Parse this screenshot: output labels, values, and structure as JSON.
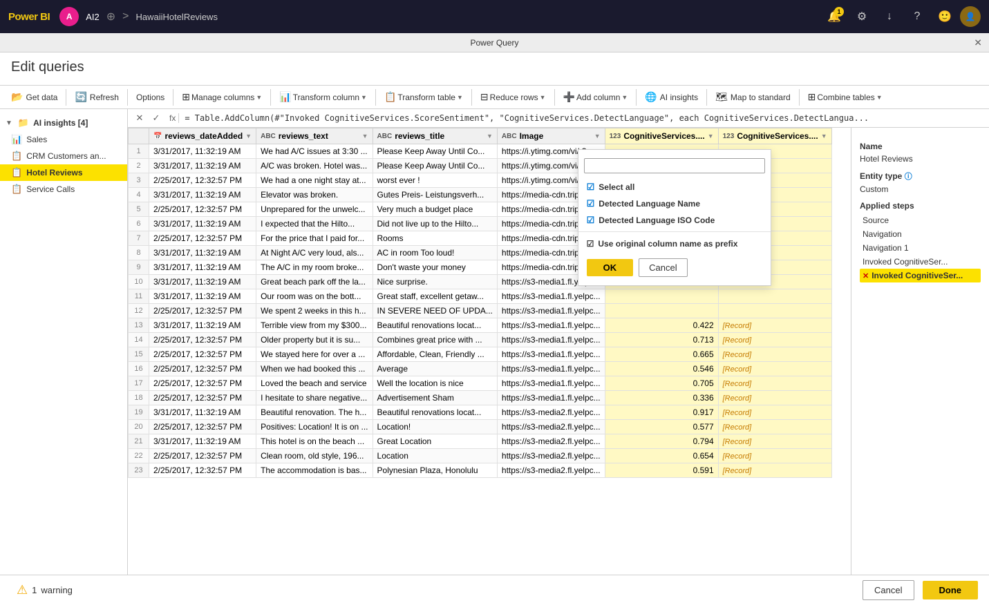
{
  "topnav": {
    "logo": "Power BI",
    "user_initial": "A",
    "user_label": "AI2",
    "breadcrumb_sep": ">",
    "breadcrumb": "HawaiiHotelReviews",
    "notification_count": "1",
    "icons": {
      "settings": "⚙",
      "download": "↓",
      "help": "?",
      "emoji": "🙂"
    }
  },
  "pq": {
    "title_bar": "Power Query",
    "close_icon": "✕",
    "page_title": "Edit queries"
  },
  "toolbar": {
    "get_data": "Get data",
    "refresh": "Refresh",
    "options": "Options",
    "manage_columns": "Manage columns",
    "transform_column": "Transform column",
    "transform_table": "Transform table",
    "reduce_rows": "Reduce rows",
    "add_column": "Add column",
    "ai_insights": "AI insights",
    "map_to_standard": "Map to standard",
    "combine_tables": "Combine tables"
  },
  "sidebar": {
    "group_label": "AI insights [4]",
    "items": [
      {
        "label": "Sales",
        "icon": "📊",
        "active": false
      },
      {
        "label": "CRM Customers an...",
        "icon": "📋",
        "active": false
      },
      {
        "label": "Hotel Reviews",
        "icon": "📋",
        "active": true
      },
      {
        "label": "Service Calls",
        "icon": "📋",
        "active": false
      }
    ]
  },
  "formula_bar": {
    "cancel_icon": "✕",
    "confirm_icon": "✓",
    "fx_label": "fx",
    "formula": "= Table.AddColumn(#\"Invoked CognitiveServices.ScoreSentiment\", \"CognitiveServices.DetectLanguage\", each CognitiveServices.DetectLangua..."
  },
  "grid": {
    "columns": [
      {
        "name": "reviews_dateAdded",
        "type": "📅"
      },
      {
        "name": "reviews_text",
        "type": "ABC"
      },
      {
        "name": "reviews_title",
        "type": "ABC"
      },
      {
        "name": "Image",
        "type": "ABC"
      },
      {
        "name": "CognitiveServices....",
        "type": "123"
      },
      {
        "name": "CognitiveServices....",
        "type": "123"
      }
    ],
    "rows": [
      [
        1,
        "3/31/2017, 11:32:19 AM",
        "We had A/C issues at 3:30 ...",
        "Please Keep Away Until Co...",
        "https://i.ytimg.com/vi/-3s...",
        "",
        ""
      ],
      [
        2,
        "3/31/2017, 11:32:19 AM",
        "A/C was broken. Hotel was...",
        "Please Keep Away Until Co...",
        "https://i.ytimg.com/vi/gV...",
        "",
        ""
      ],
      [
        3,
        "2/25/2017, 12:32:57 PM",
        "We had a one night stay at...",
        "worst ever !",
        "https://i.ytimg.com/vi/xcE...",
        "",
        ""
      ],
      [
        4,
        "3/31/2017, 11:32:19 AM",
        "Elevator was broken.",
        "Gutes Preis- Leistungsverh...",
        "https://media-cdn.tripady...",
        "",
        ""
      ],
      [
        5,
        "2/25/2017, 12:32:57 PM",
        "Unprepared for the unwelc...",
        "Very much a budget place",
        "https://media-cdn.tripady...",
        "",
        ""
      ],
      [
        6,
        "3/31/2017, 11:32:19 AM",
        "I expected that the Hilto...",
        "Did not live up to the Hilto...",
        "https://media-cdn.tripady...",
        "",
        ""
      ],
      [
        7,
        "2/25/2017, 12:32:57 PM",
        "For the price that I paid for...",
        "Rooms",
        "https://media-cdn.tripady...",
        "",
        ""
      ],
      [
        8,
        "3/31/2017, 11:32:19 AM",
        "At Night A/C very loud, als...",
        "AC in room Too loud!",
        "https://media-cdn.tripady...",
        "",
        ""
      ],
      [
        9,
        "3/31/2017, 11:32:19 AM",
        "The A/C in my room broke...",
        "Don't waste your money",
        "https://media-cdn.tripady...",
        "",
        ""
      ],
      [
        10,
        "3/31/2017, 11:32:19 AM",
        "Great beach park off the la...",
        "Nice surprise.",
        "https://s3-media1.fl.yelpc...",
        "",
        ""
      ],
      [
        11,
        "3/31/2017, 11:32:19 AM",
        "Our room was on the bott...",
        "Great staff, excellent getaw...",
        "https://s3-media1.fl.yelpc...",
        "",
        ""
      ],
      [
        12,
        "2/25/2017, 12:32:57 PM",
        "We spent 2 weeks in this h...",
        "IN SEVERE NEED OF UPDA...",
        "https://s3-media1.fl.yelpc...",
        "",
        ""
      ],
      [
        13,
        "3/31/2017, 11:32:19 AM",
        "Terrible view from my $300...",
        "Beautiful renovations locat...",
        "https://s3-media1.fl.yelpc...",
        "0.422",
        "[Record]"
      ],
      [
        14,
        "2/25/2017, 12:32:57 PM",
        "Older property but it is su...",
        "Combines great price with ...",
        "https://s3-media1.fl.yelpc...",
        "0.713",
        "[Record]"
      ],
      [
        15,
        "2/25/2017, 12:32:57 PM",
        "We stayed here for over a ...",
        "Affordable, Clean, Friendly ...",
        "https://s3-media1.fl.yelpc...",
        "0.665",
        "[Record]"
      ],
      [
        16,
        "2/25/2017, 12:32:57 PM",
        "When we had booked this ...",
        "Average",
        "https://s3-media1.fl.yelpc...",
        "0.546",
        "[Record]"
      ],
      [
        17,
        "2/25/2017, 12:32:57 PM",
        "Loved the beach and service",
        "Well the location is nice",
        "https://s3-media1.fl.yelpc...",
        "0.705",
        "[Record]"
      ],
      [
        18,
        "2/25/2017, 12:32:57 PM",
        "I hesitate to share negative...",
        "Advertisement Sham",
        "https://s3-media1.fl.yelpc...",
        "0.336",
        "[Record]"
      ],
      [
        19,
        "3/31/2017, 11:32:19 AM",
        "Beautiful renovation. The h...",
        "Beautiful renovations locat...",
        "https://s3-media2.fl.yelpc...",
        "0.917",
        "[Record]"
      ],
      [
        20,
        "2/25/2017, 12:32:57 PM",
        "Positives: Location! It is on ...",
        "Location!",
        "https://s3-media2.fl.yelpc...",
        "0.577",
        "[Record]"
      ],
      [
        21,
        "3/31/2017, 11:32:19 AM",
        "This hotel is on the beach ...",
        "Great Location",
        "https://s3-media2.fl.yelpc...",
        "0.794",
        "[Record]"
      ],
      [
        22,
        "2/25/2017, 12:32:57 PM",
        "Clean room, old style, 196...",
        "Location",
        "https://s3-media2.fl.yelpc...",
        "0.654",
        "[Record]"
      ],
      [
        23,
        "2/25/2017, 12:32:57 PM",
        "The accommodation is bas...",
        "Polynesian Plaza, Honolulu",
        "https://s3-media2.fl.yelpc...",
        "0.591",
        "[Record]"
      ]
    ]
  },
  "column_dropdown": {
    "search_placeholder": "",
    "items": [
      {
        "label": "Select all",
        "checked": true
      },
      {
        "label": "Detected Language Name",
        "checked": true
      },
      {
        "label": "Detected Language ISO Code",
        "checked": true
      }
    ],
    "use_prefix_label": "Use original column name as prefix",
    "use_prefix_checked": true,
    "ok_label": "OK",
    "cancel_label": "Cancel"
  },
  "right_panel": {
    "name_label": "Name",
    "name_value": "Hotel Reviews",
    "entity_type_label": "Entity type",
    "entity_type_value": "Custom",
    "applied_steps_label": "Applied steps",
    "steps": [
      {
        "label": "Source",
        "active": false,
        "removable": false
      },
      {
        "label": "Navigation",
        "active": false,
        "removable": false
      },
      {
        "label": "Navigation 1",
        "active": false,
        "removable": false
      },
      {
        "label": "Invoked CognitiveSer...",
        "active": false,
        "removable": false
      },
      {
        "label": "Invoked CognitiveSer...",
        "active": true,
        "removable": true
      }
    ]
  },
  "bottombar": {
    "warning_icon": "⚠",
    "warning_count": "1",
    "warning_label": "warning",
    "cancel_label": "Cancel",
    "done_label": "Done"
  }
}
